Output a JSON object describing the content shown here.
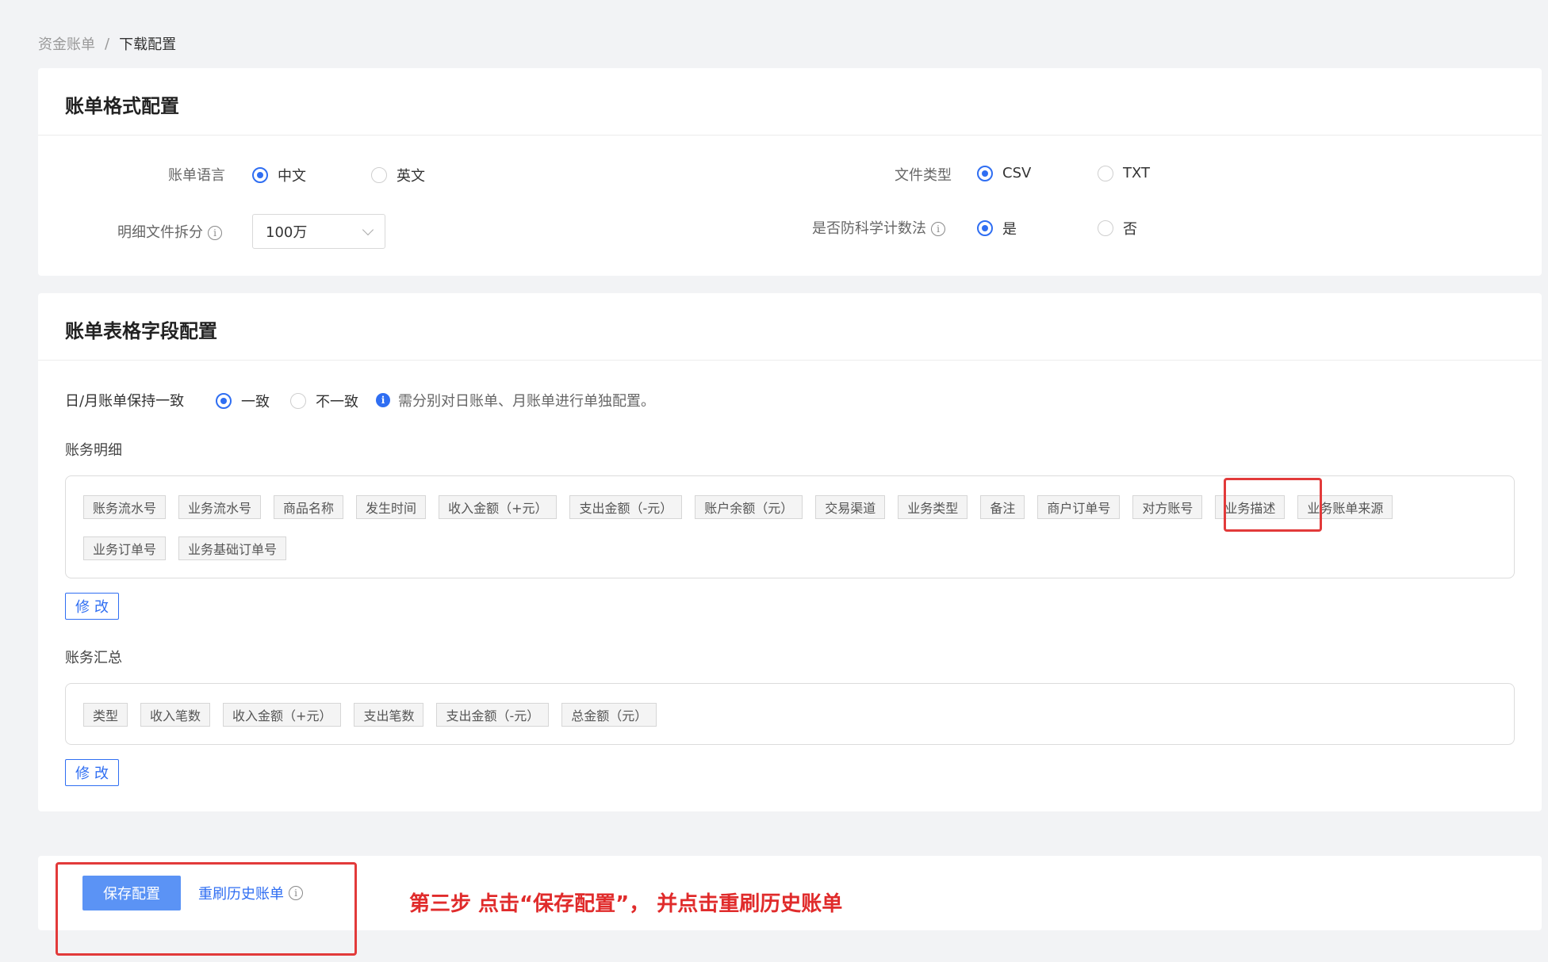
{
  "breadcrumb": {
    "parent": "资金账单",
    "separator": "/",
    "current": "下载配置"
  },
  "format_section": {
    "title": "账单格式配置",
    "language_label": "账单语言",
    "language_options": [
      "中文",
      "英文"
    ],
    "language_selected": "中文",
    "file_type_label": "文件类型",
    "file_type_options": [
      "CSV",
      "TXT"
    ],
    "file_type_selected": "CSV",
    "split_label": "明细文件拆分",
    "split_value": "100万",
    "benford_label": "是否防科学计数法",
    "benford_options": [
      "是",
      "否"
    ],
    "benford_selected": "是"
  },
  "fields_section": {
    "title": "账单表格字段配置",
    "consistency_label": "日/月账单保持一致",
    "consistency_options": [
      "一致",
      "不一致"
    ],
    "consistency_selected": "一致",
    "consistency_hint": "需分别对日账单、月账单进行单独配置。",
    "detail_label": "账务明细",
    "detail_tags_row1": [
      "账务流水号",
      "业务流水号",
      "商品名称",
      "发生时间",
      "收入金额（+元）",
      "支出金额（-元）",
      "账户余额（元）",
      "交易渠道",
      "业务类型",
      "备注",
      "商户订单号",
      "对方账号",
      "业务描述",
      "业务账单来源"
    ],
    "detail_tags_row2": [
      "业务订单号",
      "业务基础订单号"
    ],
    "summary_label": "账务汇总",
    "summary_tags": [
      "类型",
      "收入笔数",
      "收入金额（+元）",
      "支出笔数",
      "支出金额（-元）",
      "总金额（元）"
    ],
    "edit_label": "修改"
  },
  "actions": {
    "save_label": "保存配置",
    "refresh_label": "重刷历史账单"
  },
  "annotation": "第三步 点击“保存配置”， 并点击重刷历史账单",
  "colors": {
    "primary": "#2f6ef2",
    "highlight": "#e23a3a",
    "annotation": "#e02b2b"
  },
  "icons": {
    "info": "info-circle-icon",
    "chevron": "chevron-down-icon"
  }
}
